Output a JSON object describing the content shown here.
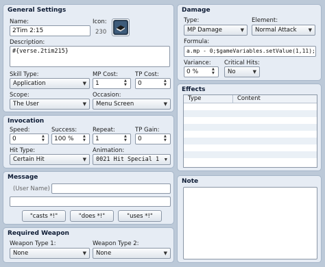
{
  "general": {
    "title": "General Settings",
    "name_label": "Name:",
    "name_value": "2Tim 2:15",
    "icon_label": "Icon:",
    "icon_index": "230",
    "description_label": "Description:",
    "description_value": "#{verse.2tim215}",
    "skill_type_label": "Skill Type:",
    "skill_type_value": "Application",
    "mp_cost_label": "MP Cost:",
    "mp_cost_value": "1",
    "tp_cost_label": "TP Cost:",
    "tp_cost_value": "0",
    "scope_label": "Scope:",
    "scope_value": "The User",
    "occasion_label": "Occasion:",
    "occasion_value": "Menu Screen"
  },
  "invocation": {
    "title": "Invocation",
    "speed_label": "Speed:",
    "speed_value": "0",
    "success_label": "Success:",
    "success_value": "100 %",
    "repeat_label": "Repeat:",
    "repeat_value": "1",
    "tp_gain_label": "TP Gain:",
    "tp_gain_value": "0",
    "hit_type_label": "Hit Type:",
    "hit_type_value": "Certain Hit",
    "animation_label": "Animation:",
    "animation_value": "0021 Hit Special 1"
  },
  "message": {
    "title": "Message",
    "user_name_placeholder": "(User Name)",
    "btn_casts": "\"casts *!\"",
    "btn_does": "\"does *!\"",
    "btn_uses": "\"uses *!\""
  },
  "required_weapon": {
    "title": "Required Weapon",
    "type1_label": "Weapon Type 1:",
    "type1_value": "None",
    "type2_label": "Weapon Type 2:",
    "type2_value": "None"
  },
  "damage": {
    "title": "Damage",
    "type_label": "Type:",
    "type_value": "MP Damage",
    "element_label": "Element:",
    "element_value": "Normal Attack",
    "formula_label": "Formula:",
    "formula_value": "a.mp - 0;$gameVariables.setValue(1,11);",
    "variance_label": "Variance:",
    "variance_value": "0 %",
    "critical_label": "Critical Hits:",
    "critical_value": "No"
  },
  "effects": {
    "title": "Effects",
    "col_type": "Type",
    "col_content": "Content"
  },
  "note": {
    "title": "Note"
  },
  "colors": {
    "background": "#bcc9d8",
    "panel": "#e6ecf4",
    "row_alt": "#eaf0f6"
  }
}
